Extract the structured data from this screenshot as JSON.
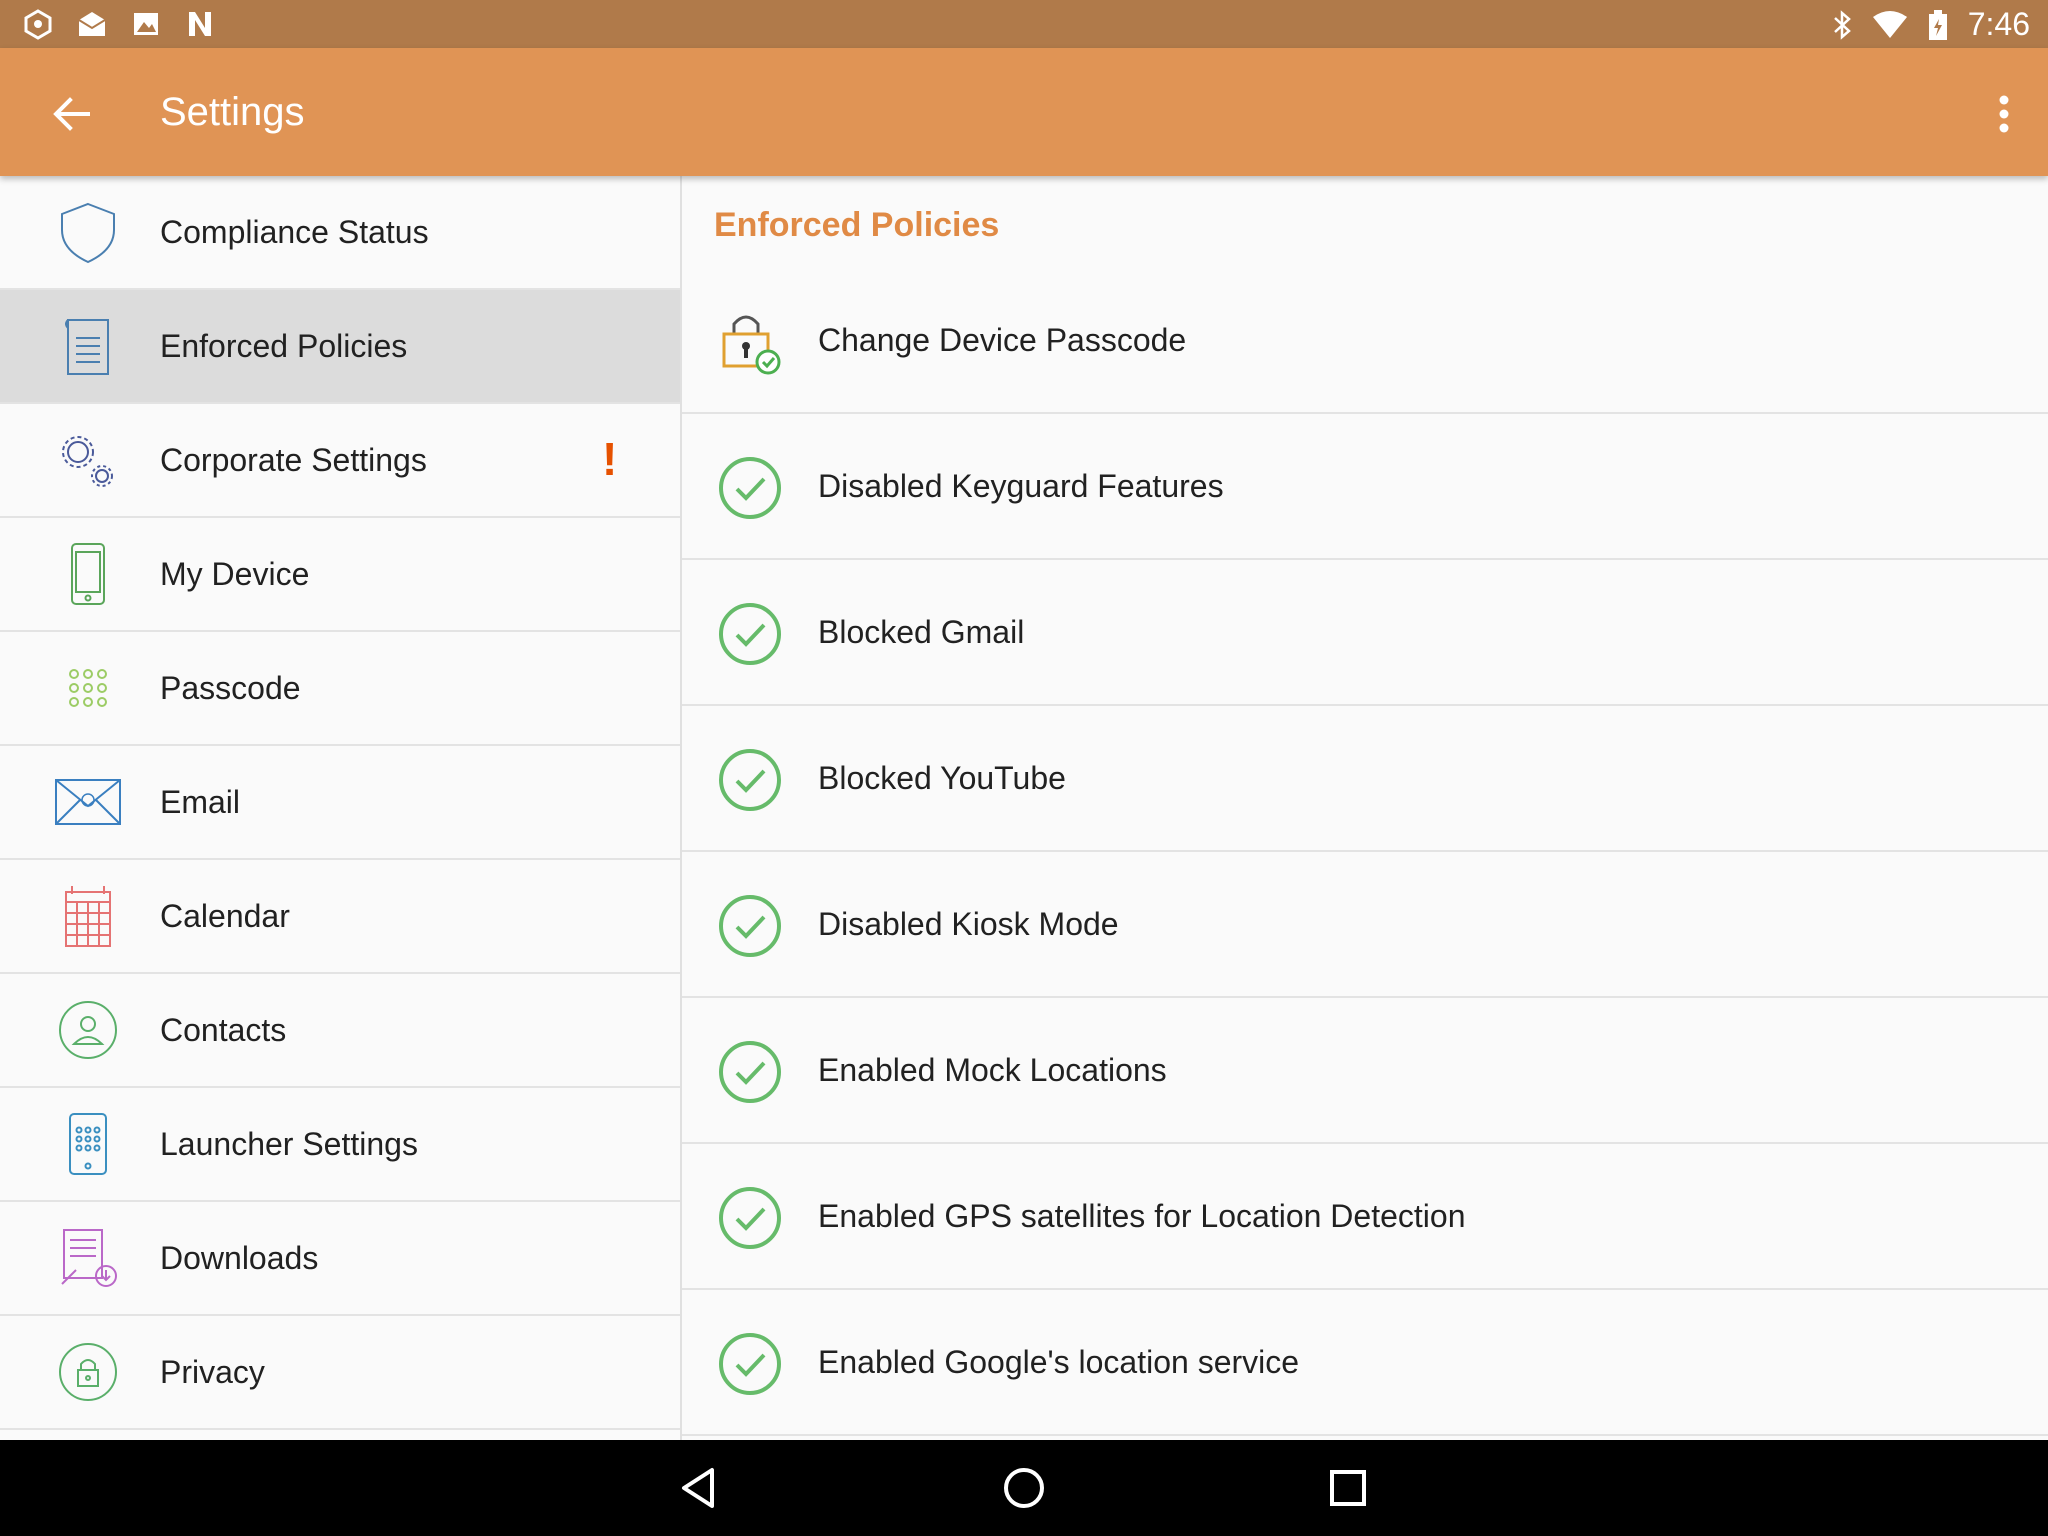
{
  "status_bar": {
    "time": "7:46"
  },
  "app_bar": {
    "title": "Settings"
  },
  "nav": {
    "items": [
      {
        "label": "Compliance Status"
      },
      {
        "label": "Enforced Policies"
      },
      {
        "label": "Corporate Settings",
        "badge": "!"
      },
      {
        "label": "My Device"
      },
      {
        "label": "Passcode"
      },
      {
        "label": "Email"
      },
      {
        "label": "Calendar"
      },
      {
        "label": "Contacts"
      },
      {
        "label": "Launcher Settings"
      },
      {
        "label": "Downloads"
      },
      {
        "label": "Privacy"
      }
    ],
    "selected_index": 1
  },
  "content": {
    "section_title": "Enforced Policies",
    "policies": [
      {
        "label": "Change Device Passcode"
      },
      {
        "label": "Disabled Keyguard Features"
      },
      {
        "label": "Blocked Gmail"
      },
      {
        "label": "Blocked YouTube"
      },
      {
        "label": "Disabled Kiosk Mode"
      },
      {
        "label": "Enabled Mock Locations"
      },
      {
        "label": "Enabled GPS satellites for Location Detection"
      },
      {
        "label": "Enabled Google's location service"
      }
    ]
  },
  "colors": {
    "status_bar": "#b07a4a",
    "app_bar": "#e09455",
    "section_title": "#e08a45",
    "check_green": "#66bb6a",
    "warning": "#e65100"
  }
}
